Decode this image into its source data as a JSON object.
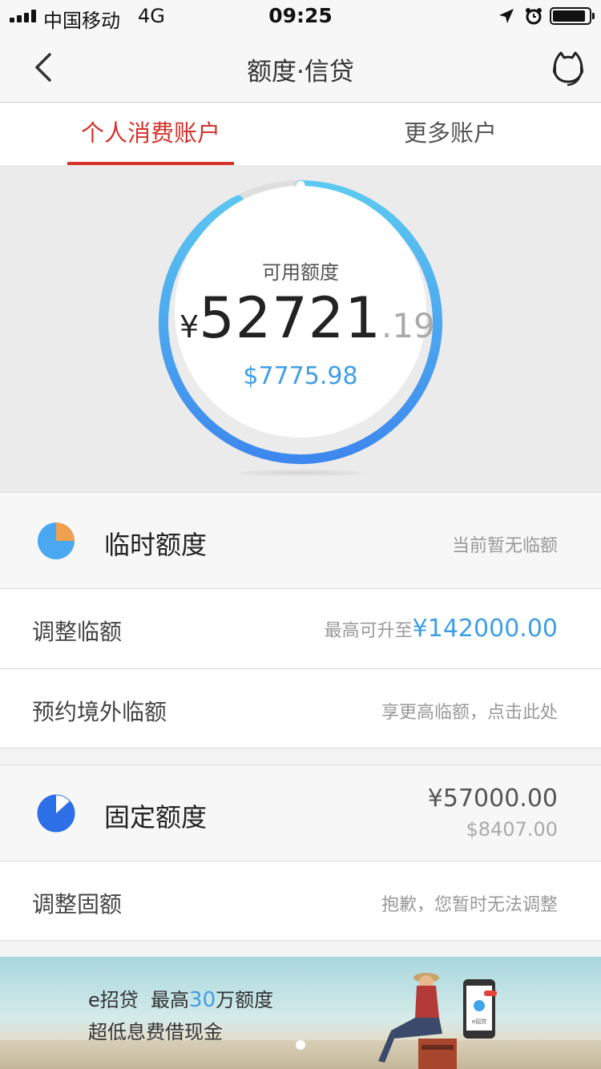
{
  "status_bar": {
    "carrier": "中国移动",
    "network": "4G",
    "time": "09:25"
  },
  "nav": {
    "title": "额度·信贷",
    "back_icon": "chevron-left-icon",
    "service_icon": "customer-service-icon"
  },
  "tabs": [
    {
      "label": "个人消费账户",
      "active": true
    },
    {
      "label": "更多账户",
      "active": false
    }
  ],
  "credit": {
    "label": "可用额度",
    "currency_symbol": "¥",
    "amount_integer": "52721",
    "amount_decimal": ".19",
    "usd_amount": "$7775.98",
    "available_fraction": 0.925
  },
  "temp_quota": {
    "title": "临时额度",
    "status": "当前暂无临额",
    "icon": "pie-chart-icon"
  },
  "adjust_temp": {
    "label": "调整临额",
    "hint_prefix": "最高可升至",
    "max_amount": "¥142000.00"
  },
  "overseas_temp": {
    "label": "预约境外临额",
    "hint": "享更高临额，点击此处"
  },
  "fixed_quota": {
    "title": "固定额度",
    "cny": "¥57000.00",
    "usd": "$8407.00",
    "icon": "pie-chart-icon"
  },
  "adjust_fixed": {
    "label": "调整固额",
    "hint": "抱歉，您暂时无法调整"
  },
  "banner": {
    "brand": "e招贷",
    "line1_prefix": "最高",
    "line1_number": "30",
    "line1_suffix": "万额度",
    "line2": "超低息费借现金",
    "phone_label": "e招贷"
  },
  "colors": {
    "accent_red": "#d5322b",
    "accent_blue": "#3f9fe6"
  }
}
